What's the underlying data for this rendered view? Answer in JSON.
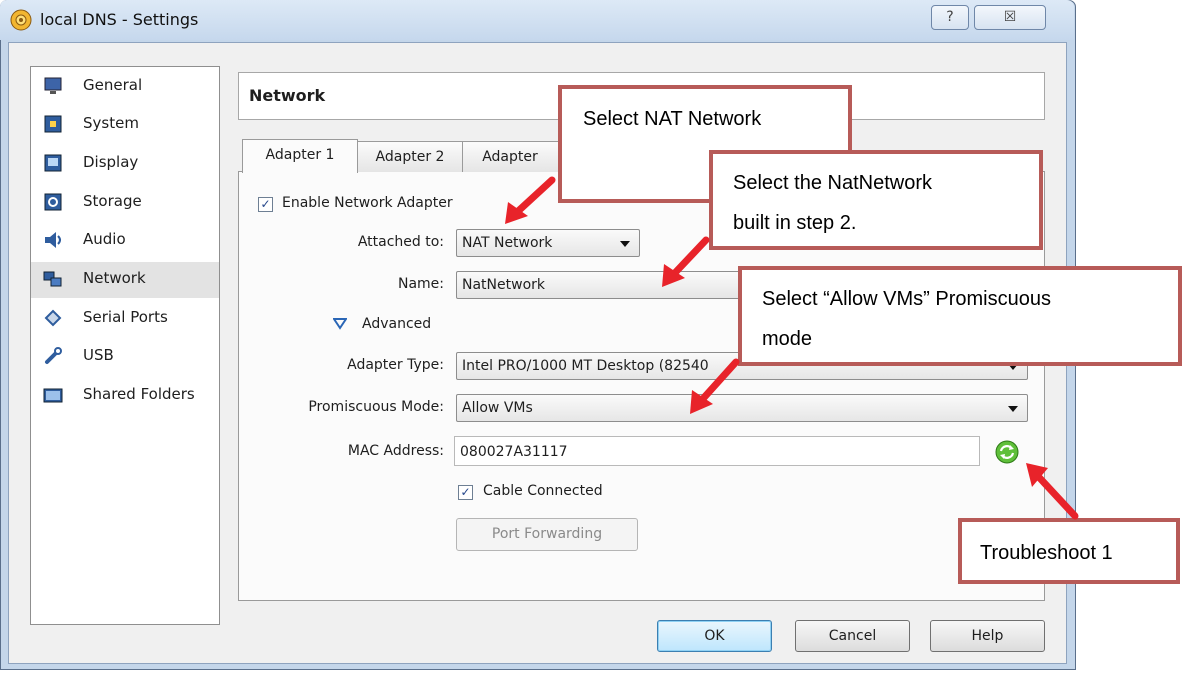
{
  "window": {
    "title": "local DNS - Settings",
    "help_glyph": "?",
    "close_glyph": "☒"
  },
  "sidebar": {
    "items": [
      {
        "label": "General",
        "icon": "monitor-icon",
        "selected": false
      },
      {
        "label": "System",
        "icon": "chip-icon",
        "selected": false
      },
      {
        "label": "Display",
        "icon": "display-icon",
        "selected": false
      },
      {
        "label": "Storage",
        "icon": "storage-icon",
        "selected": false
      },
      {
        "label": "Audio",
        "icon": "speaker-icon",
        "selected": false
      },
      {
        "label": "Network",
        "icon": "network-icon",
        "selected": true
      },
      {
        "label": "Serial Ports",
        "icon": "serial-port-icon",
        "selected": false
      },
      {
        "label": "USB",
        "icon": "usb-icon",
        "selected": false
      },
      {
        "label": "Shared Folders",
        "icon": "folder-icon",
        "selected": false
      }
    ]
  },
  "header": {
    "title": "Network"
  },
  "tabs": [
    {
      "label": "Adapter 1",
      "active": true
    },
    {
      "label": "Adapter 2",
      "active": false
    },
    {
      "label": "Adapter",
      "active": false
    }
  ],
  "form": {
    "enable_adapter_label": "Enable Network Adapter",
    "enable_adapter_checked": true,
    "attached_label": "Attached to:",
    "attached_value": "NAT Network",
    "name_label": "Name:",
    "name_value": "NatNetwork",
    "advanced_label": "Advanced",
    "adapter_type_label": "Adapter Type:",
    "adapter_type_value": "Intel PRO/1000 MT Desktop (82540",
    "promiscuous_label": "Promiscuous Mode:",
    "promiscuous_value": "Allow VMs",
    "mac_label": "MAC Address:",
    "mac_value": "080027A31117",
    "cable_label": "Cable Connected",
    "cable_checked": true,
    "port_forwarding_label": "Port Forwarding"
  },
  "buttons": {
    "ok": "OK",
    "cancel": "Cancel",
    "help": "Help"
  },
  "callouts": {
    "nat": "Select NAT Network",
    "natnetwork_line1": "Select the NatNetwork",
    "natnetwork_line2": "built in step 2.",
    "promisc_line1": "Select “Allow VMs” Promiscuous",
    "promisc_line2": "mode",
    "troubleshoot": "Troubleshoot 1"
  },
  "colors": {
    "callout_border": "#b75b58",
    "arrow": "#e8232a",
    "selection": "#e3e3e3"
  }
}
